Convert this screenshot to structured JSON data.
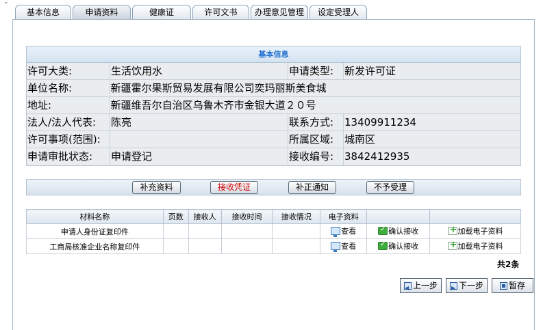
{
  "tabs": [
    {
      "label": "基本信息"
    },
    {
      "label": "申请资料"
    },
    {
      "label": "健康证"
    },
    {
      "label": "许可文书"
    },
    {
      "label": "办理意见管理"
    },
    {
      "label": "设定受理人"
    }
  ],
  "info": {
    "header": "基本信息",
    "license_category_label": "许可大类:",
    "license_category": "生活饮用水",
    "application_type_label": "申请类型:",
    "application_type": "新发许可证",
    "unit_name_label": "单位名称:",
    "unit_name": "新疆霍尔果斯贸易发展有限公司奕玛丽斯美食城",
    "address_label": "地址:",
    "address": "新疆维吾尔自治区乌鲁木齐市金银大道２０号",
    "legal_rep_label": "法人/法人代表:",
    "legal_rep": "陈亮",
    "contact_label": "联系方式:",
    "contact": "13409911234",
    "license_scope_label": "许可事项(范围):",
    "license_scope": "",
    "district_label": "所属区域:",
    "district": "城南区",
    "approval_status_label": "申请审批状态:",
    "approval_status": "申请登记",
    "receipt_no_label": "接收编号:",
    "receipt_no": "3842412935"
  },
  "actions": {
    "supplement": "补充资料",
    "receipt": "接收凭证",
    "correction": "补正通知",
    "reject": "不予受理"
  },
  "materials": {
    "headers": [
      "材料名称",
      "页数",
      "接收人",
      "接收时间",
      "接收情况",
      "电子资料",
      "",
      ""
    ],
    "rows": [
      {
        "name": "申请人身份证复印件",
        "pages": "",
        "receiver": "",
        "time": "",
        "status": "",
        "view": "查看",
        "confirm": "确认接收",
        "load": "加载电子资料"
      },
      {
        "name": "工商局核准企业名称复印件",
        "pages": "",
        "receiver": "",
        "time": "",
        "status": "",
        "view": "查看",
        "confirm": "确认接收",
        "load": "加载电子资料"
      }
    ],
    "total": "共2条"
  },
  "nav": {
    "prev": "上一步",
    "next": "下一步",
    "save": "暂存"
  }
}
